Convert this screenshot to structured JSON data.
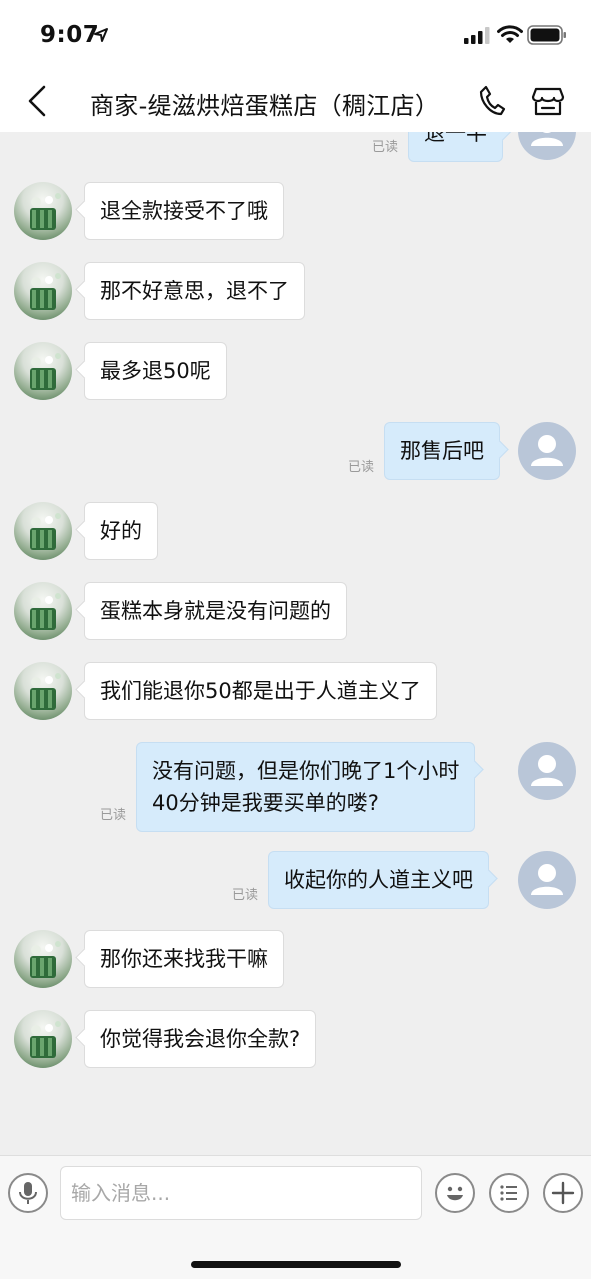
{
  "status_bar": {
    "time": "9:07"
  },
  "header": {
    "title": "商家-缇滋烘焙蛋糕店（稠江店）"
  },
  "messages": [
    {
      "side": "right",
      "text": "退一半",
      "read": "已读"
    },
    {
      "side": "left",
      "text": "退全款接受不了哦"
    },
    {
      "side": "left",
      "text": "那不好意思，退不了"
    },
    {
      "side": "left",
      "text": "最多退50呢"
    },
    {
      "side": "right",
      "text": "那售后吧",
      "read": "已读"
    },
    {
      "side": "left",
      "text": "好的"
    },
    {
      "side": "left",
      "text": "蛋糕本身就是没有问题的"
    },
    {
      "side": "left",
      "text": "我们能退你50都是出于人道主义了"
    },
    {
      "side": "right",
      "lines": [
        "没有问题，但是你们晚了1个小时",
        "40分钟是我要买单的喽?"
      ],
      "read": "已读"
    },
    {
      "side": "right",
      "text": "收起你的人道主义吧",
      "read": "已读"
    },
    {
      "side": "left",
      "text": "那你还来找我干嘛"
    },
    {
      "side": "left",
      "text": "你觉得我会退你全款?"
    }
  ],
  "input": {
    "placeholder": "输入消息..."
  },
  "icons": {
    "back": "chevron-left-icon",
    "phone": "phone-icon",
    "shop": "store-icon",
    "voice": "microphone-icon",
    "emoji": "smiley-icon",
    "quick_reply": "list-icon",
    "more": "plus-icon"
  },
  "colors": {
    "bubble_self": "#d6ebfb",
    "bubble_other": "#ffffff",
    "background": "#efefef"
  }
}
